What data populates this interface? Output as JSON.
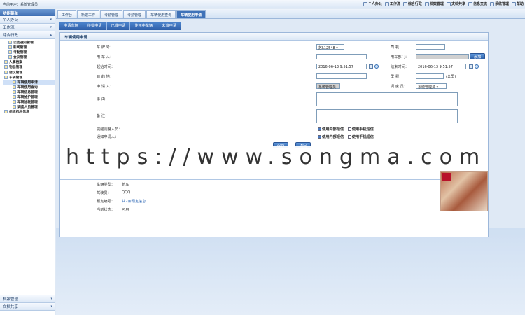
{
  "topbar": {
    "user": "当前用户：系统管理员",
    "tools": [
      "个人办公",
      "工作流",
      "综合行政",
      "档案管理",
      "文档共享",
      "信息交流",
      "系统管理",
      "帮助"
    ]
  },
  "sidebar": {
    "header": "功能菜单",
    "groups": [
      "个人办公",
      "工作流",
      "综合行政"
    ],
    "tree": [
      "公告通知管理",
      "新闻管理",
      "考勤管理",
      "会议管理",
      "人事档案",
      "物品管理",
      "会议管理",
      "车辆管理",
      "车辆使用申请",
      "车辆使用查询",
      "车辆信息管理",
      "车辆维护管理",
      "车辆油耗管理",
      "调度人员管理",
      "组织机构信息"
    ],
    "bottom_groups": [
      "档案管理",
      "文档共享"
    ]
  },
  "tabs": [
    "工作台",
    "新建工作",
    "考勤管理",
    "考勤管理",
    "车辆使用查询",
    "车辆使用申请"
  ],
  "subtabs": [
    "申请车辆",
    "待批申请",
    "已准申请",
    "使用中车辆",
    "未准申请"
  ],
  "panel": {
    "title": "车辆使用申请",
    "labels": {
      "plate": "车 牌 号：",
      "driver": "司 机：",
      "user": "用 车 人：",
      "dept": "用车部门：",
      "start": "起始时间：",
      "end": "结束时间：",
      "dest": "目 的 地：",
      "mileage": "里 程：",
      "applicant": "申 请 人：",
      "dispatcher": "调 度 员：",
      "reason": "事 由：",
      "remark": "备 注：",
      "remind_dispatcher": "提醒调度人员：",
      "notify_applicant": "通知申请人："
    },
    "values": {
      "plate": "苏L12548",
      "start": "2016-06-13 9:51:57",
      "end": "2016-06-13 9:51:57",
      "mileage_unit": "(公里)",
      "applicant": "系统管理员",
      "dispatcher": "系统管理员",
      "dept_button": "添加"
    },
    "check_options": [
      "使用内部短信",
      "使用手机短信"
    ],
    "buttons": {
      "save": "保存",
      "back": "返回"
    }
  },
  "watermark": "https://www.songma.com",
  "vehicle_info": {
    "labels": [
      "车辆类型：",
      "驾驶员：",
      "预定编号：",
      "当前状态："
    ],
    "values": [
      "轿车",
      "QQQ",
      "共2条预定信息",
      "可用"
    ]
  },
  "colors": {
    "accent": "#3f72b8",
    "border": "#9cb7da"
  }
}
